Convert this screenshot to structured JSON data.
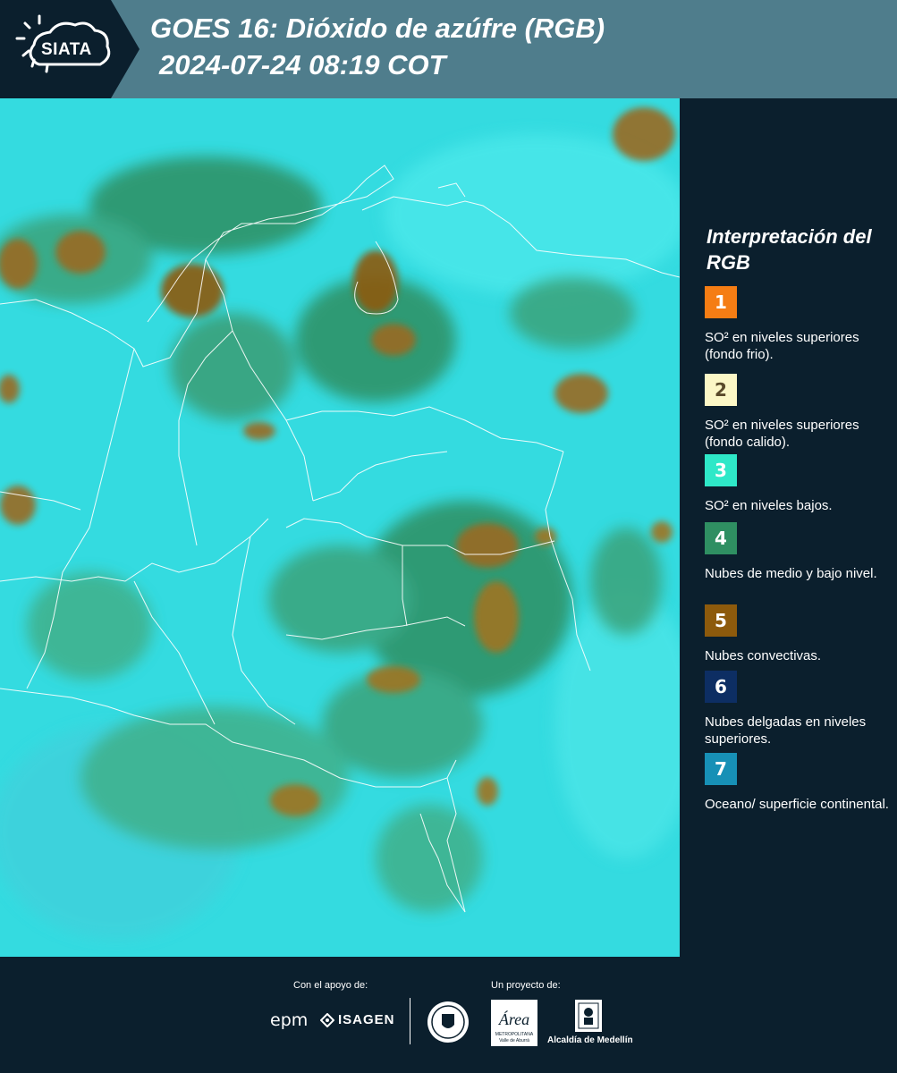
{
  "header": {
    "logo_text": "SIATA",
    "title_line1": "GOES 16: Dióxido de azúfre (RGB)",
    "title_line2": "2024-07-24 08:19 COT"
  },
  "map": {
    "image_description_icon": "satellite-rgb-map",
    "background_color": "#2fd6dc"
  },
  "legend": {
    "title": "Interpretación del RGB",
    "items": [
      {
        "number": "1",
        "color": "#f57d14",
        "text_color": "#ffffff",
        "label": "SO² en niveles superiores (fondo frio)."
      },
      {
        "number": "2",
        "color": "#fcf7c6",
        "text_color": "#5a4a2a",
        "label": "SO² en niveles superiores (fondo calido)."
      },
      {
        "number": "3",
        "color": "#2ee8c8",
        "text_color": "#ffffff",
        "label": "SO² en niveles bajos."
      },
      {
        "number": "4",
        "color": "#2f8f62",
        "text_color": "#ffffff",
        "label": "Nubes de medio y bajo nivel."
      },
      {
        "number": "5",
        "color": "#8d5a0c",
        "text_color": "#ffffff",
        "label": "Nubes convectivas."
      },
      {
        "number": "6",
        "color": "#0d2e63",
        "text_color": "#ffffff",
        "label": "Nubes delgadas en niveles superiores."
      },
      {
        "number": "7",
        "color": "#1790b6",
        "text_color": "#ffffff",
        "label": "Oceano/ superficie continental."
      }
    ]
  },
  "footer": {
    "support_label": "Con el apoyo de:",
    "project_label": "Un proyecto de:",
    "epm_text": "epm",
    "isagen_text": "ISAGEN",
    "area_text": "Área",
    "area_subtext": "METROPOLITANA",
    "area_subtext2": "Valle de Aburrá",
    "alcaldia_text": "Alcaldía de Medellín"
  }
}
